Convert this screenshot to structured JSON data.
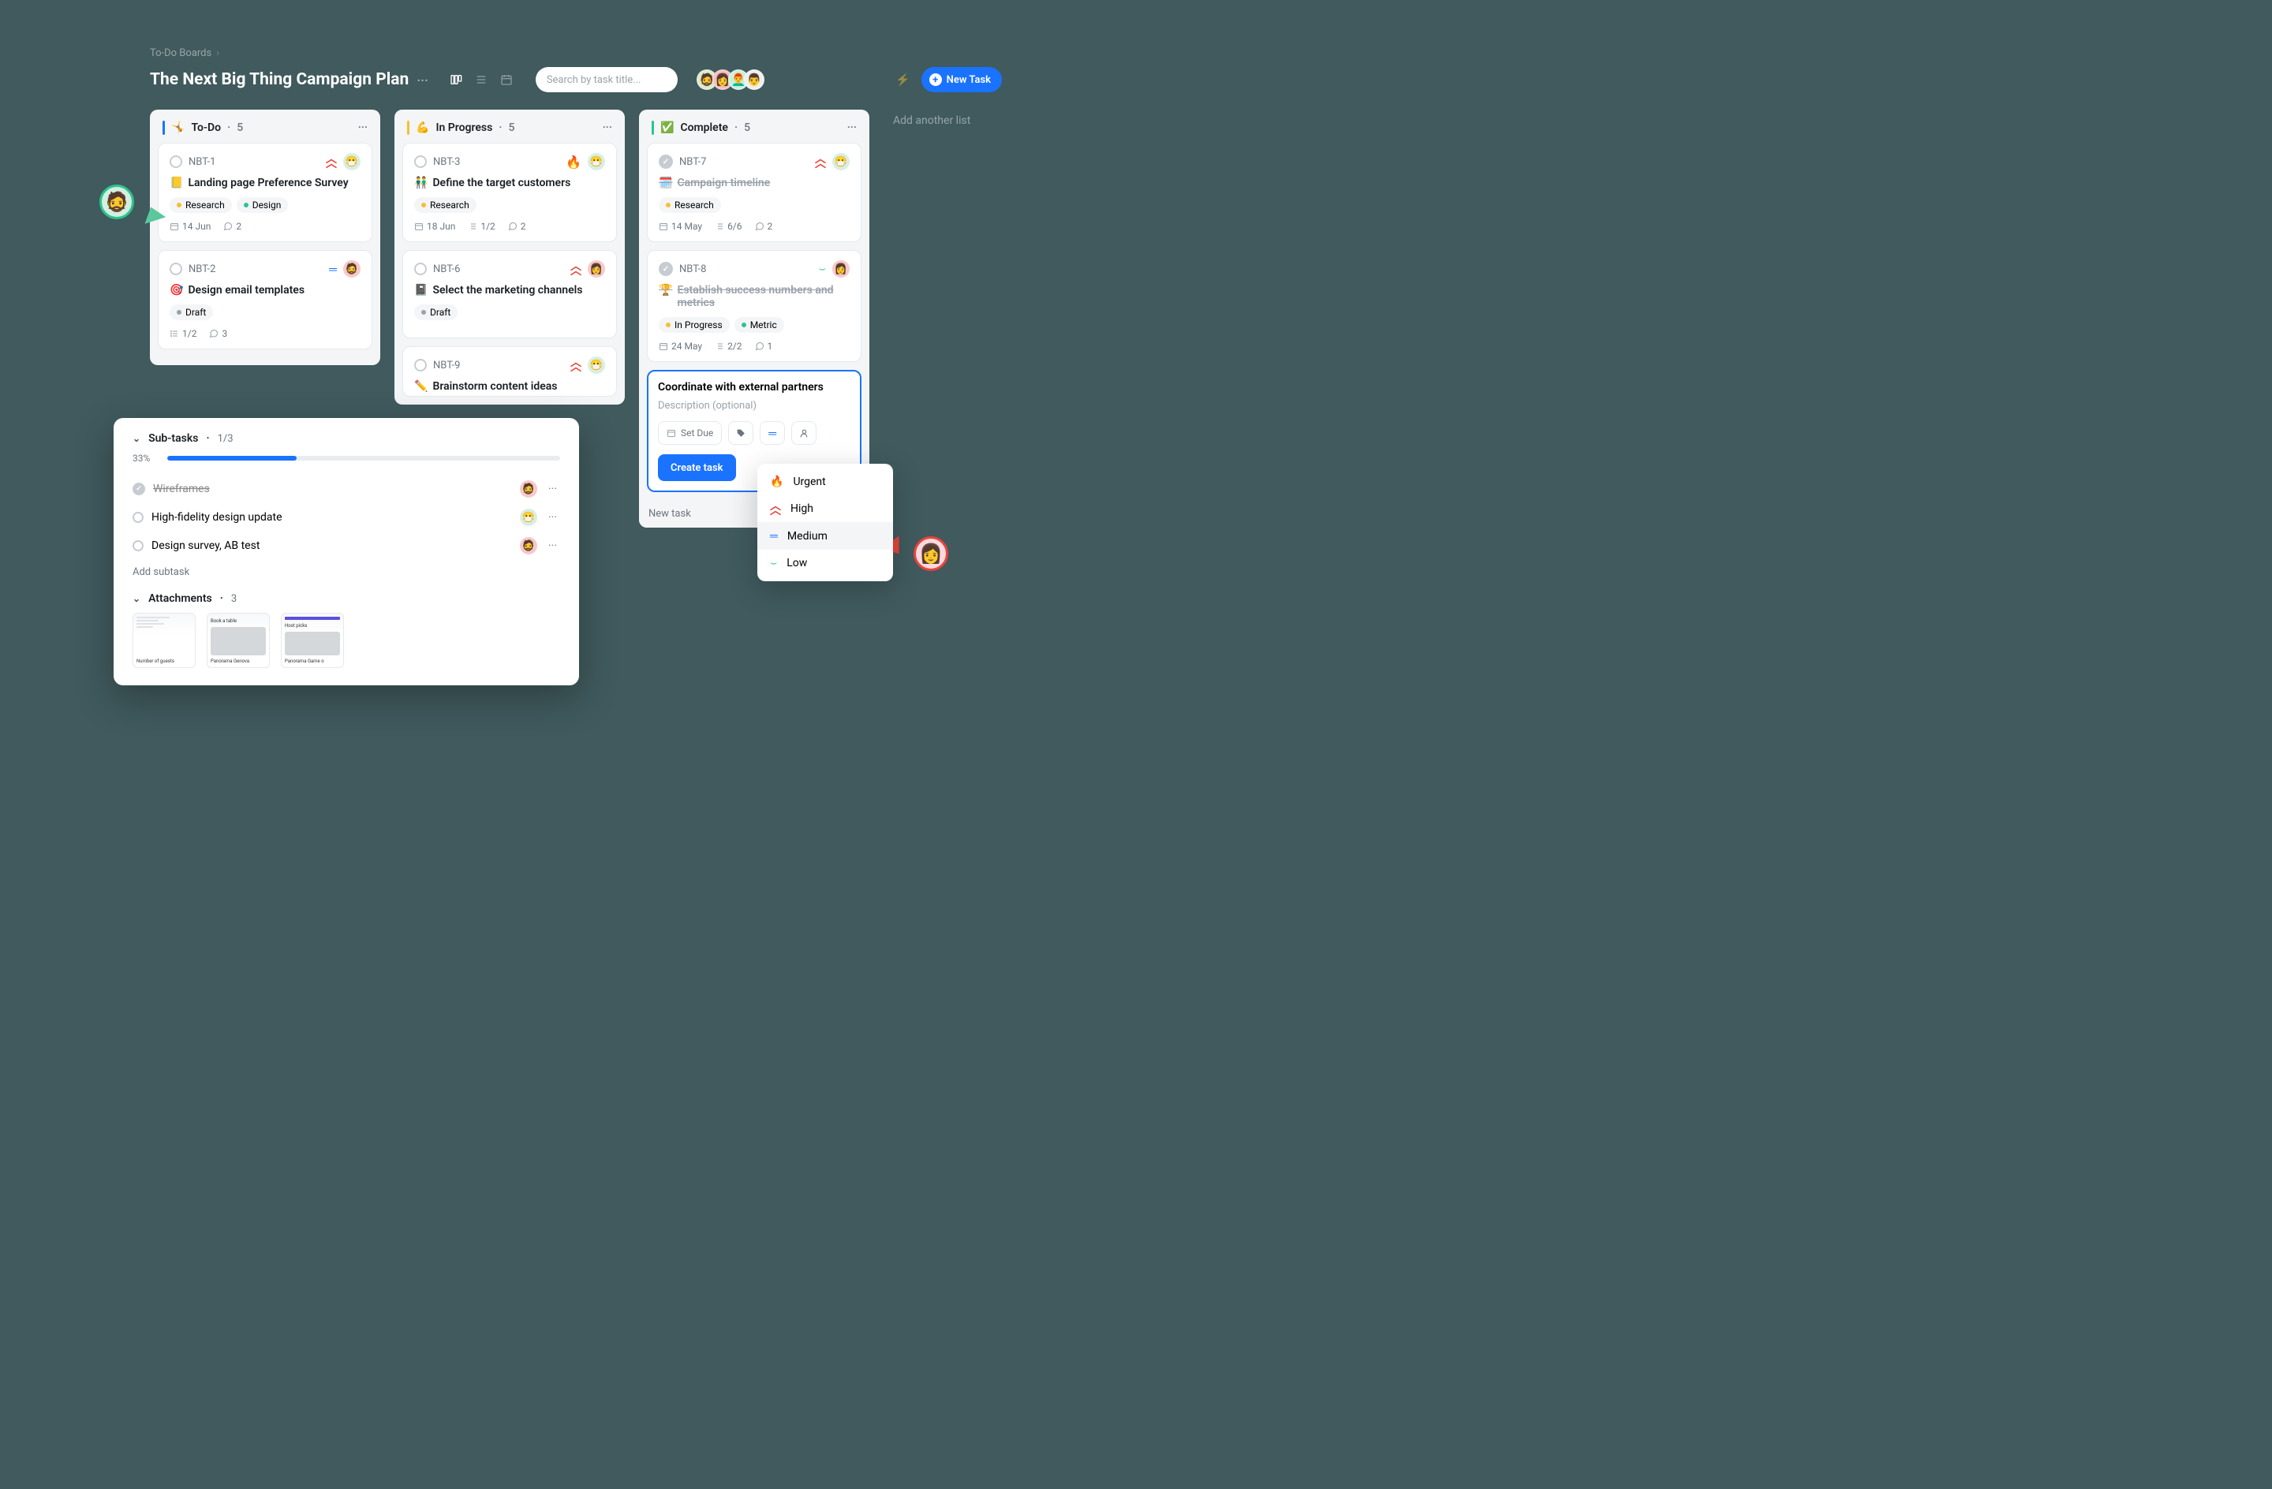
{
  "breadcrumb": {
    "root": "To-Do Boards"
  },
  "board": {
    "title": "The Next Big Thing Campaign Plan",
    "search_placeholder": "Search by task title...",
    "new_task_label": "New Task",
    "add_list_label": "Add another list"
  },
  "header_avatars": [
    "🧔",
    "👩",
    "👨‍🦰",
    "👨"
  ],
  "columns": {
    "todo": {
      "emoji": "🤸",
      "name": "To-Do",
      "count": "5",
      "bar_color": "#1a73ff",
      "cards": [
        {
          "id": "NBT-1",
          "emoji": "📒",
          "title": "Landing page Preference Survey",
          "done": false,
          "priority": "high",
          "assignee": "😷",
          "assignee_bg": "bg-g",
          "tags": [
            {
              "label": "Research",
              "variant": "yellow"
            },
            {
              "label": "Design",
              "variant": "green"
            }
          ],
          "meta": {
            "date": "14 Jun",
            "subtasks": "",
            "comments": "2"
          }
        },
        {
          "id": "NBT-2",
          "emoji": "🎯",
          "title": "Design email templates",
          "done": false,
          "priority": "med",
          "assignee": "🧔",
          "assignee_bg": "bg-r",
          "tags": [
            {
              "label": "Draft",
              "variant": "grey"
            }
          ],
          "meta": {
            "date": "",
            "subtasks": "1/2",
            "comments": "3"
          }
        }
      ]
    },
    "progress": {
      "emoji": "💪",
      "name": "In Progress",
      "count": "5",
      "bar_color": "#f3c036",
      "cards": [
        {
          "id": "NBT-3",
          "emoji": "👬",
          "title": "Define the target customers",
          "done": false,
          "priority": "urgent",
          "assignee": "😷",
          "assignee_bg": "bg-g",
          "tags": [
            {
              "label": "Research",
              "variant": "yellow"
            }
          ],
          "meta": {
            "date": "18 Jun",
            "subtasks": "1/2",
            "comments": "2"
          }
        },
        {
          "id": "NBT-6",
          "emoji": "📓",
          "title": "Select the marketing channels",
          "done": false,
          "priority": "high",
          "assignee": "👩",
          "assignee_bg": "bg-r",
          "tags": [
            {
              "label": "Draft",
              "variant": "grey"
            }
          ],
          "meta": {
            "date": "",
            "subtasks": "",
            "comments": ""
          }
        },
        {
          "id": "NBT-9",
          "emoji": "✏️",
          "title": "Brainstorm content ideas",
          "done": false,
          "priority": "high",
          "assignee": "😷",
          "assignee_bg": "bg-g",
          "tags": [],
          "meta": {
            "date": "",
            "subtasks": "",
            "comments": ""
          },
          "truncated": true
        }
      ]
    },
    "complete": {
      "emoji": "✅",
      "name": "Complete",
      "count": "5",
      "bar_color": "#2cc48f",
      "cards": [
        {
          "id": "NBT-7",
          "emoji": "🗓️",
          "title": "Campaign timeline",
          "done": true,
          "priority": "high",
          "assignee": "😷",
          "assignee_bg": "bg-g",
          "tags": [
            {
              "label": "Research",
              "variant": "yellow"
            }
          ],
          "meta": {
            "date": "14 May",
            "subtasks": "6/6",
            "comments": "2"
          }
        },
        {
          "id": "NBT-8",
          "emoji": "🏆",
          "title": "Establish success numbers and metrics",
          "done": true,
          "priority": "low",
          "assignee": "👩",
          "assignee_bg": "bg-r",
          "tags": [
            {
              "label": "In Progress",
              "variant": "yellow"
            },
            {
              "label": "Metric",
              "variant": "green"
            }
          ],
          "meta": {
            "date": "24 May",
            "subtasks": "2/2",
            "comments": "1"
          }
        }
      ],
      "new_task": {
        "title": "Coordinate with external partners",
        "desc_placeholder": "Description (optional)",
        "set_due": "Set Due",
        "create_label": "Create task",
        "footer_label": "New task"
      }
    }
  },
  "priority_dropdown": {
    "items": [
      {
        "icon": "🔥",
        "label": "Urgent",
        "class": ""
      },
      {
        "icon": "high",
        "label": "High",
        "class": "high"
      },
      {
        "icon": "med",
        "label": "Medium",
        "class": "med",
        "hover": true
      },
      {
        "icon": "low",
        "label": "Low",
        "class": "low"
      }
    ]
  },
  "subtask_panel": {
    "title": "Sub-tasks",
    "fraction": "1/3",
    "percent": "33%",
    "percent_num": 33,
    "items": [
      {
        "title": "Wireframes",
        "done": true,
        "assignee": "🧔",
        "bg": "bg-r"
      },
      {
        "title": "High-fidelity design update",
        "done": false,
        "assignee": "😷",
        "bg": "bg-g"
      },
      {
        "title": "Design survey, AB test",
        "done": false,
        "assignee": "🧔",
        "bg": "bg-r"
      }
    ],
    "add_label": "Add subtask",
    "attachments": {
      "title": "Attachments",
      "count": "3",
      "items": [
        {
          "caption1": "Number of guests",
          "caption2": ""
        },
        {
          "caption1": "Book a table",
          "caption2": "Panorama   Genova"
        },
        {
          "caption1": "Host picks",
          "caption2": "Panorama   Game o"
        }
      ]
    }
  }
}
